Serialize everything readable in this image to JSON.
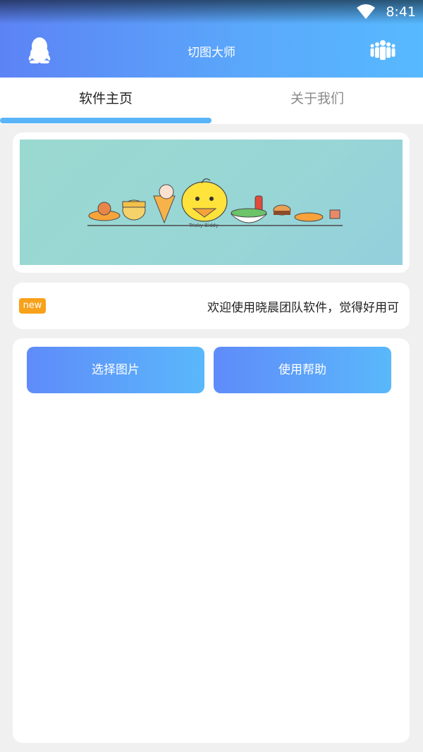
{
  "status_bar": {
    "time": "8:41"
  },
  "header": {
    "title": "切图大师",
    "left_icon": "qq-penguin-icon",
    "right_icon": "team-icon"
  },
  "tabs": [
    {
      "label": "软件主页",
      "active": true
    },
    {
      "label": "关于我们",
      "active": false
    }
  ],
  "banner": {
    "alt": "banner-illustration",
    "caption": "Tricky Biddy"
  },
  "notice": {
    "badge": "new",
    "text": "欢迎使用晓晨团队软件，觉得好用可"
  },
  "actions": {
    "select_image": "选择图片",
    "help": "使用帮助"
  },
  "colors": {
    "accent_start": "#5c83f5",
    "accent_end": "#57b9ff",
    "badge": "#f7a21b",
    "indicator": "#5ab4f8"
  }
}
